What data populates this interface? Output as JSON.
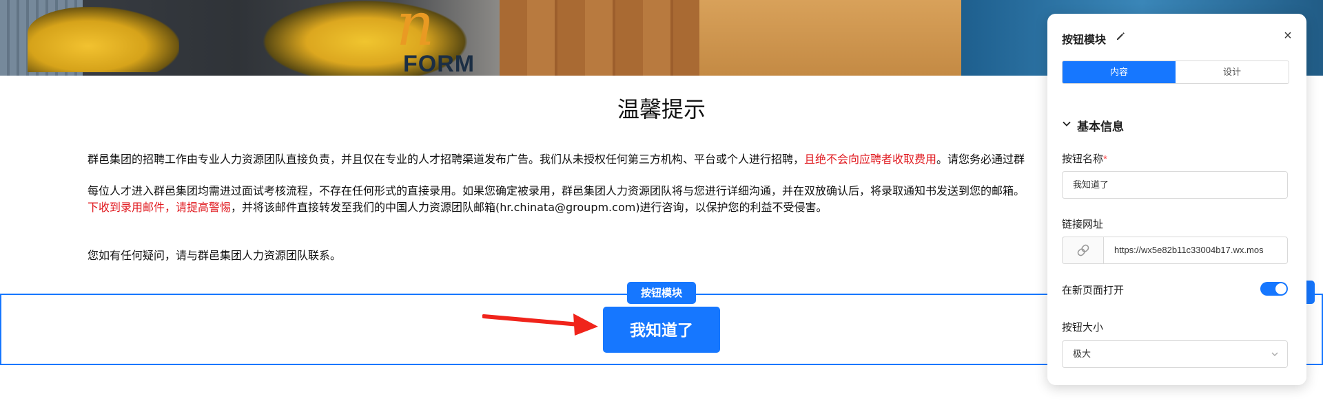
{
  "notice": {
    "title": "温馨提示",
    "p1_a": "群邑集团的招聘工作由专业人力资源团队直接负责，并且仅在专业的人才招聘渠道发布广告。我们从未授权任何第三方机构、平台或个人进行招聘，",
    "p1_red": "且绝不会向应聘者收取费用",
    "p1_b": "。请您务必通过群",
    "p2_line1": "每位人才进入群邑集团均需进过面试考核流程，不存在任何形式的直接录用。如果您确定被录用，群邑集团人力资源团队将与您进行详细沟通，并在双放确认后，将录取通知书发送到您的邮箱。",
    "p2_red": "下收到录用邮件，请提高警惕",
    "p2_line2": "，并将该邮件直接转发至我们的中国人力资源团队邮箱(hr.chinata@groupm.com)进行咨询，以保护您的利益不受侵害。",
    "p3": "您如有任何疑问，请与群邑集团人力资源团队联系。"
  },
  "banner": {
    "logo_text": "FORM"
  },
  "button_block": {
    "tag": "按钮模块",
    "cta_label": "我知道了"
  },
  "panel": {
    "title": "按钮模块",
    "tabs": [
      "内容",
      "设计"
    ],
    "section_title": "基本信息",
    "button_name_label": "按钮名称",
    "button_name_required": "*",
    "button_name_value": "我知道了",
    "link_label": "链接网址",
    "link_value": "https://wx5e82b11c33004b17.wx.mos",
    "new_page_label": "在新页面打开",
    "new_page_enabled": true,
    "size_label": "按钮大小",
    "size_value": "极大"
  },
  "colors": {
    "primary": "#1677ff",
    "warning_red": "#e0171d"
  }
}
